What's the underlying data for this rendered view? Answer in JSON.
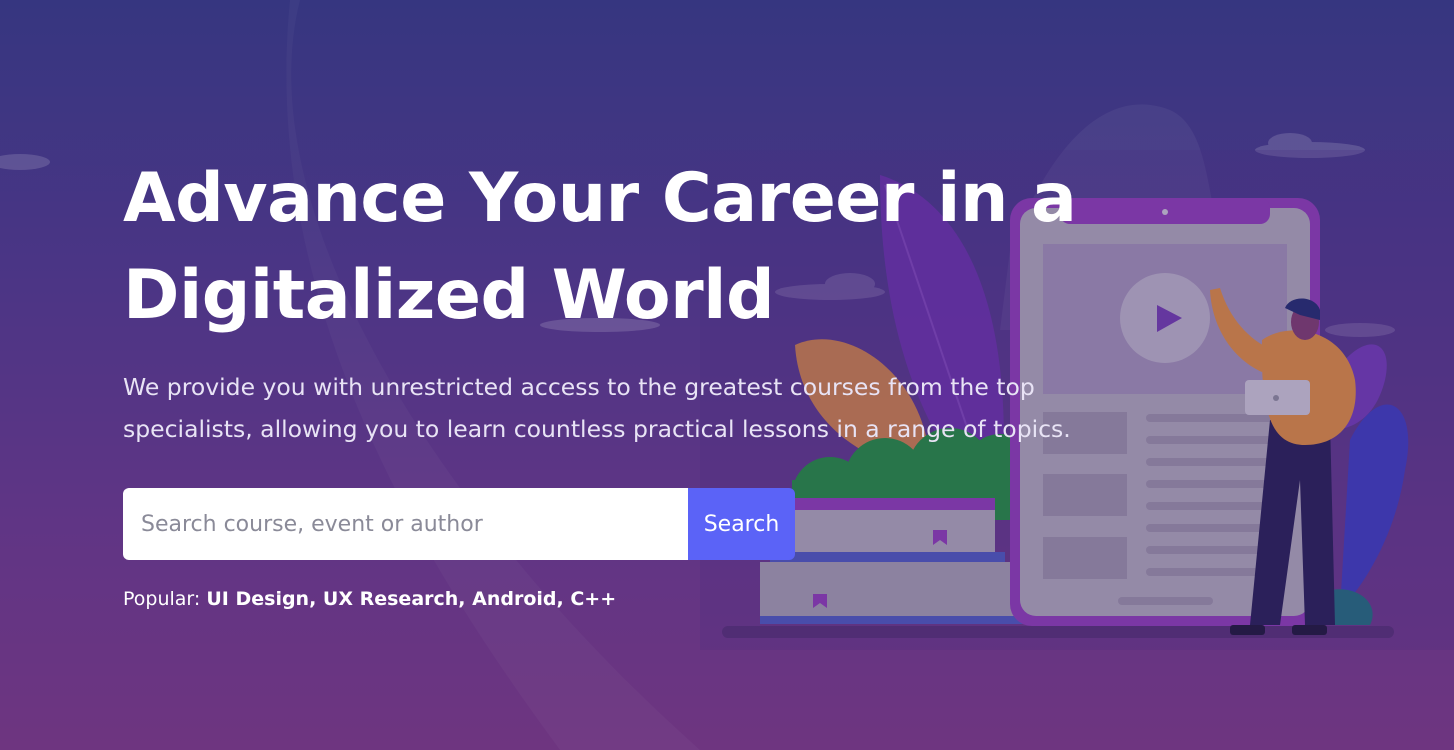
{
  "hero": {
    "headline_line1": "Advance Your Career in a",
    "headline_line2": "Digitalized World",
    "subheadline": "We provide you with unrestricted access to the greatest courses from the top specialists, allowing you to learn countless practical lessons in a range of topics."
  },
  "search": {
    "placeholder": "Search course, event or author",
    "value": "",
    "button_label": "Search"
  },
  "popular": {
    "label": "Popular:",
    "tags": "UI Design, UX Research, Android, C++"
  },
  "colors": {
    "background_top": "#363680",
    "background_bottom": "#6e3580",
    "accent": "#5b63f7",
    "text": "#ffffff"
  }
}
